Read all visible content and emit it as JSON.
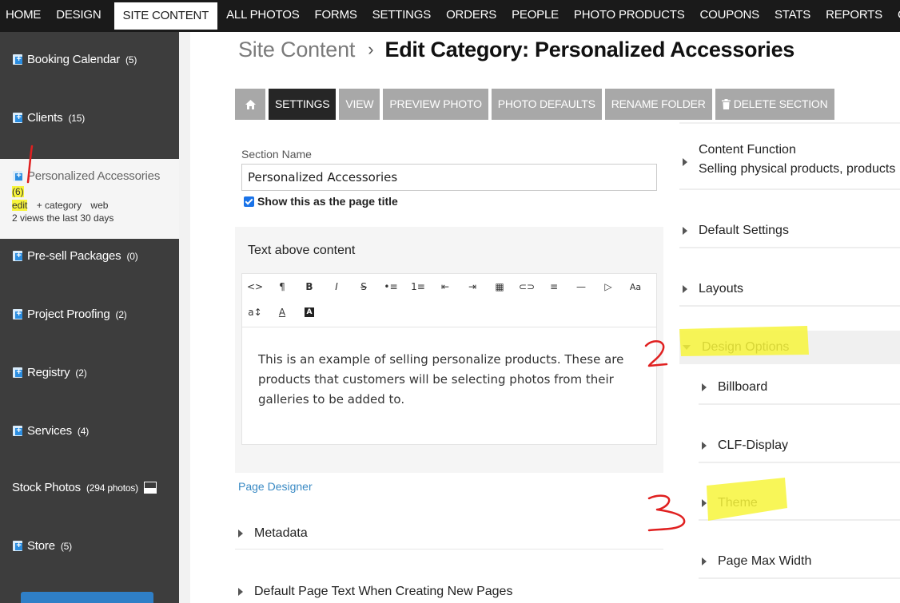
{
  "topnav": {
    "items": [
      {
        "label": "HOME"
      },
      {
        "label": "DESIGN"
      },
      {
        "label": "SITE CONTENT",
        "active": true
      },
      {
        "label": "ALL PHOTOS"
      },
      {
        "label": "FORMS"
      },
      {
        "label": "SETTINGS"
      },
      {
        "label": "ORDERS"
      },
      {
        "label": "PEOPLE"
      },
      {
        "label": "PHOTO PRODUCTS"
      },
      {
        "label": "COUPONS"
      },
      {
        "label": "STATS"
      },
      {
        "label": "REPORTS"
      },
      {
        "label": "CALENDAR"
      }
    ]
  },
  "sidebar": {
    "items": [
      {
        "label": "Booking Calendar",
        "count": "(5)"
      },
      {
        "label": "Clients",
        "count": "(15)"
      },
      {
        "label": "Personalized Accessories",
        "count": "(6)",
        "actions": [
          "edit",
          "+ category",
          "web"
        ],
        "views": "2 views the last 30 days"
      },
      {
        "label": "Pre-sell Packages",
        "count": "(0)"
      },
      {
        "label": "Project Proofing",
        "count": "(2)"
      },
      {
        "label": "Registry",
        "count": "(2)"
      },
      {
        "label": "Services",
        "count": "(4)"
      },
      {
        "label": "Stock Photos",
        "count": "(294 photos)"
      },
      {
        "label": "Store",
        "count": "(5)"
      }
    ]
  },
  "breadcrumb": {
    "parent": "Site Content",
    "separator": "›",
    "current": "Edit Category: Personalized Accessories"
  },
  "toolbar": {
    "home_icon": "home-icon",
    "buttons": [
      "SETTINGS",
      "VIEW",
      "PREVIEW PHOTO",
      "PHOTO DEFAULTS",
      "RENAME FOLDER",
      "DELETE SECTION"
    ],
    "delete_icon": "trash-icon"
  },
  "form": {
    "section_name_label": "Section Name",
    "section_name_value": "Personalized Accessories",
    "show_title_label": "Show this as the page title",
    "show_title_checked": true,
    "editor_title": "Text above content",
    "editor_text": "This is an example of selling personalize products. These are products that customers will be selecting photos from their galleries to be added to.",
    "page_designer_link": "Page Designer",
    "sections": [
      "Metadata",
      "Default Page Text When Creating New Pages"
    ]
  },
  "editor_toolbar": {
    "row1": [
      "<>",
      "¶",
      "B",
      "I",
      "S",
      "•≡",
      "1≡",
      "⇤",
      "⇥",
      "▦",
      "⊂⊃",
      "≡",
      "—",
      "▷",
      "Aa"
    ],
    "row2": [
      "a↕",
      "A",
      "A"
    ]
  },
  "right_panel": {
    "content_function_title": "Content Function",
    "content_function_value": "Selling physical products, products",
    "items": [
      "Default Settings",
      "Layouts"
    ],
    "design_options": "Design Options",
    "design_sub_items": [
      "Billboard",
      "CLF-Display",
      "Theme",
      "Page Max Width"
    ]
  },
  "annotations": {
    "marks": [
      "1",
      "2",
      "3"
    ],
    "highlight_color": "#f7f43b",
    "ink_color": "#e02020"
  },
  "colors": {
    "nav_bg": "#1a1a1a",
    "sidebar_bg": "#3d3d3d",
    "toolbar_button": "#a8a8a8",
    "toolbar_active": "#262626",
    "link_blue": "#3a8ac4",
    "doc_icon_blue": "#2b8de0"
  }
}
